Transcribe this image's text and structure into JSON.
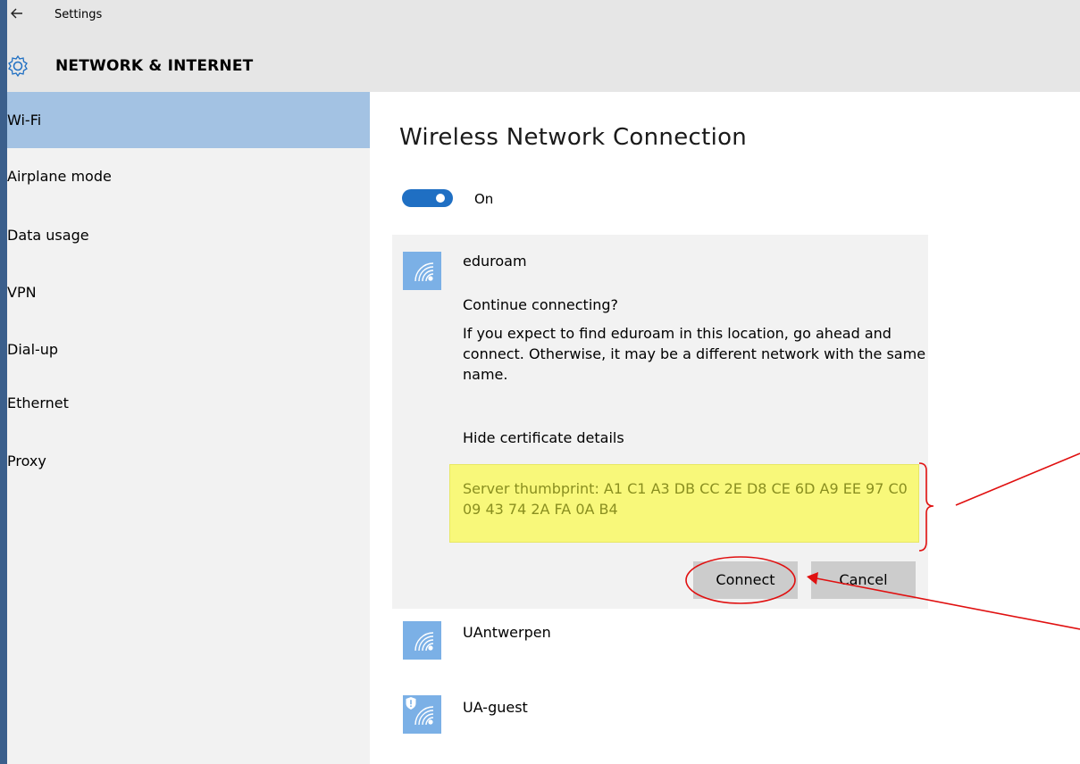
{
  "window": {
    "title": "Settings",
    "back_icon": "back-arrow-icon",
    "section_title": "NETWORK & INTERNET"
  },
  "sidebar": {
    "items": [
      {
        "label": "Wi-Fi",
        "active": true
      },
      {
        "label": "Airplane mode",
        "active": false
      },
      {
        "label": "Data usage",
        "active": false
      },
      {
        "label": "VPN",
        "active": false
      },
      {
        "label": "Dial-up",
        "active": false
      },
      {
        "label": "Ethernet",
        "active": false
      },
      {
        "label": "Proxy",
        "active": false
      }
    ]
  },
  "main": {
    "title": "Wireless Network Connection",
    "toggle_state": "On",
    "networks": [
      {
        "name": "eduroam",
        "expanded": true,
        "prompt": "Continue connecting?",
        "description": "If you expect to find eduroam in this location, go ahead and connect. Otherwise, it may be a different network with the same name.",
        "certificate_link": "Hide certificate details",
        "thumbprint_text": "Server thumbprint: A1 C1 A3 DB CC 2E D8 CE 6D A9 EE 97 C0 09 43 74 2A FA 0A B4",
        "connect_label": "Connect",
        "cancel_label": "Cancel"
      },
      {
        "name": "UAntwerpen",
        "secured_shield": false
      },
      {
        "name": "UA-guest",
        "secured_shield": true
      }
    ]
  },
  "colors": {
    "accent": "#1f6fc3",
    "sidebar_active": "#a3c2e3",
    "wifi_tile": "#7bb0e6",
    "highlight": "#f8f87a",
    "annotation": "#e01010",
    "desktop": "#3b5f8c"
  }
}
